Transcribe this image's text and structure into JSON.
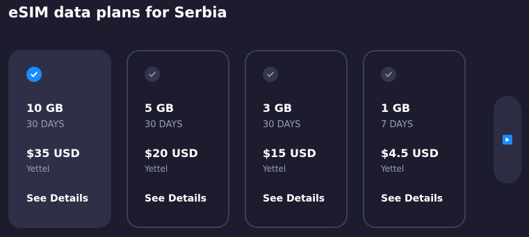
{
  "title": "eSIM data plans for Serbia",
  "colors": {
    "background": "#1c1c2e",
    "selected_card": "#2f2f47",
    "card_border": "#3e3e58",
    "accent": "#1a8cff",
    "muted_text": "#9d9db5"
  },
  "plans": [
    {
      "data": "10 GB",
      "duration": "30 DAYS",
      "price": "$35 USD",
      "carrier": "Yettel",
      "details_label": "See Details",
      "selected": true,
      "icon": "check-circle-icon"
    },
    {
      "data": "5 GB",
      "duration": "30 DAYS",
      "price": "$20 USD",
      "carrier": "Yettel",
      "details_label": "See Details",
      "selected": false,
      "icon": "check-circle-icon"
    },
    {
      "data": "3 GB",
      "duration": "30 DAYS",
      "price": "$15 USD",
      "carrier": "Yettel",
      "details_label": "See Details",
      "selected": false,
      "icon": "check-circle-icon"
    },
    {
      "data": "1 GB",
      "duration": "7 DAYS",
      "price": "$4.5 USD",
      "carrier": "Yettel",
      "details_label": "See Details",
      "selected": false,
      "icon": "check-circle-icon"
    }
  ],
  "next_button": {
    "icon": "play-arrow-icon"
  }
}
